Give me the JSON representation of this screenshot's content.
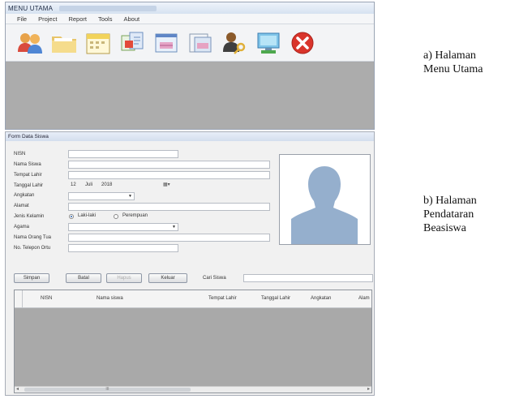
{
  "menu_window": {
    "title": "MENU UTAMA",
    "menus": [
      "File",
      "Project",
      "Report",
      "Tools",
      "About"
    ],
    "toolbar_icons": [
      "users-icon",
      "folder-icon",
      "calendar-icon",
      "translate-icon",
      "chart-icon",
      "document-chart-icon",
      "user-key-icon",
      "computer-icon",
      "close-icon"
    ]
  },
  "form_window": {
    "title": "Form Data Siswa",
    "labels": {
      "nisn": "NISN",
      "nama": "Nama Siswa",
      "tempat": "Tempat Lahir",
      "tanggal": "Tanggal Lahir",
      "angkatan": "Angkatan",
      "alamat": "Alamat",
      "jenis": "Jenis Kelamin",
      "agama": "Agama",
      "ortu": "Nama Orang Tua",
      "telp": "No. Telepon Ortu"
    },
    "date": {
      "day": "12",
      "month": "Juli",
      "year": "2018"
    },
    "gender": {
      "male": "Laki-laki",
      "female": "Perempuan",
      "selected": "male"
    },
    "buttons": {
      "save": "Simpan",
      "cancel": "Batal",
      "edit": "Hapus",
      "exit": "Keluar"
    },
    "search_label": "Cari Siswa",
    "table_columns": [
      "NISN",
      "Nama siswa",
      "Tempat Lahir",
      "Tanggal Lahir",
      "Angkatan",
      "Alam"
    ],
    "scroll_thumb": "III"
  },
  "captions": {
    "menu": [
      "a) Halaman",
      "Menu Utama"
    ],
    "form": [
      "b) Halaman",
      "Pendataran",
      "Beasiswa"
    ]
  }
}
